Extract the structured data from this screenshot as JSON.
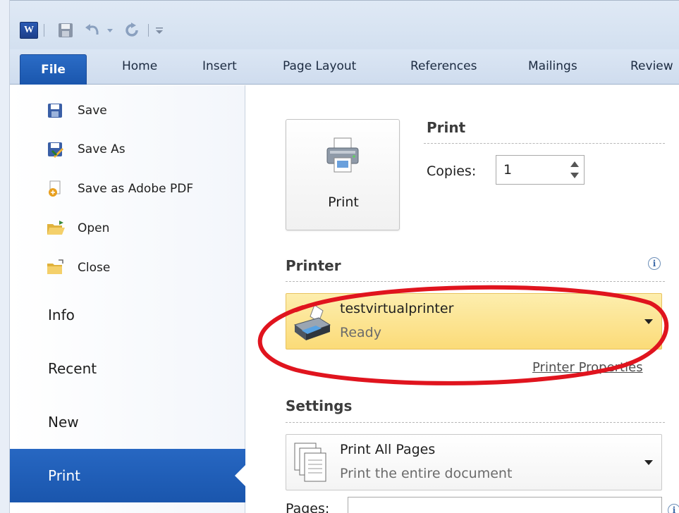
{
  "quick_access": {
    "app_logo_letter": "W"
  },
  "ribbon": {
    "tabs": [
      {
        "label": "File"
      },
      {
        "label": "Home"
      },
      {
        "label": "Insert"
      },
      {
        "label": "Page Layout"
      },
      {
        "label": "References"
      },
      {
        "label": "Mailings"
      },
      {
        "label": "Review"
      }
    ]
  },
  "backstage_nav": {
    "commands": [
      {
        "label": "Save",
        "icon": "save-icon"
      },
      {
        "label": "Save As",
        "icon": "save-as-icon"
      },
      {
        "label": "Save as Adobe PDF",
        "icon": "adobe-pdf-icon"
      },
      {
        "label": "Open",
        "icon": "open-folder-icon"
      },
      {
        "label": "Close",
        "icon": "close-folder-icon"
      }
    ],
    "tabs": [
      {
        "label": "Info"
      },
      {
        "label": "Recent"
      },
      {
        "label": "New"
      },
      {
        "label": "Print",
        "selected": true
      }
    ]
  },
  "print_panel": {
    "print_button_label": "Print",
    "section_title": "Print",
    "copies_label": "Copies:",
    "copies_value": "1",
    "printer": {
      "section_title": "Printer",
      "name": "testvirtualprinter",
      "status": "Ready",
      "properties_link": "Printer Properties"
    },
    "settings": {
      "section_title": "Settings",
      "pages_option_title": "Print All Pages",
      "pages_option_subtitle": "Print the entire document",
      "pages_label": "Pages:",
      "pages_value": ""
    }
  },
  "colors": {
    "file_tab": "#1a56ad",
    "selected_nav": "#2767c2",
    "printer_highlight": "#fbdb78",
    "annotation": "#e0141e"
  }
}
